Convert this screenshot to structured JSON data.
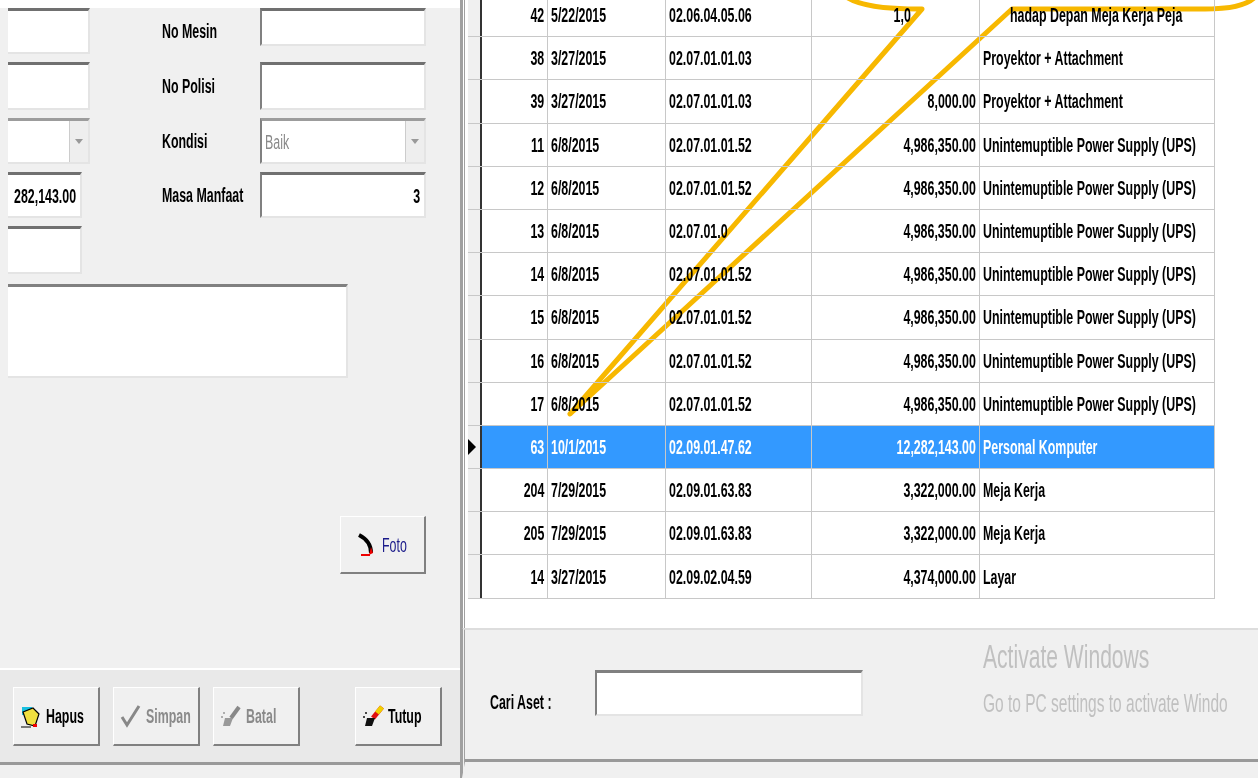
{
  "form": {
    "left_fields": [
      {
        "kind": "text",
        "disabled": false
      },
      {
        "kind": "text",
        "disabled": false
      },
      {
        "kind": "combo",
        "disabled": true
      },
      {
        "kind": "text",
        "disabled": false,
        "value": "282,143.00"
      },
      {
        "kind": "text",
        "disabled": false
      }
    ],
    "fields": [
      {
        "label": "No Mesin",
        "kind": "text",
        "disabled": false
      },
      {
        "label": "No Polisi",
        "kind": "text",
        "disabled": false
      },
      {
        "label": "Kondisi",
        "kind": "combo",
        "disabled": true,
        "value": "Baik"
      },
      {
        "label": "Masa Manfaat",
        "kind": "number",
        "disabled": false,
        "value": "3"
      }
    ],
    "photo_button": {
      "label": "Foto"
    },
    "buttons": [
      {
        "label": "Hapus",
        "kind": "delete",
        "disabled": false
      },
      {
        "label": "Simpan",
        "kind": "save",
        "disabled": true
      },
      {
        "label": "Batal",
        "kind": "cancel",
        "disabled": true
      },
      {
        "label": "Tutup",
        "kind": "close",
        "disabled": false
      }
    ]
  },
  "table": {
    "rows": [
      {
        "id": "42",
        "date": "5/22/2015",
        "code": "02.06.04.05.06",
        "amount": "1,0",
        "name": "hadap Depan Meja Kerja Peja",
        "selected": false
      },
      {
        "id": "38",
        "date": "3/27/2015",
        "code": "02.07.01.01.03",
        "name": "Proyektor + Attachment",
        "selected": false
      },
      {
        "id": "39",
        "date": "3/27/2015",
        "code": "02.07.01.01.03",
        "amount": "8,000.00",
        "name": "Proyektor + Attachment",
        "selected": false
      },
      {
        "id": "11",
        "date": "6/8/2015",
        "code": "02.07.01.01.52",
        "amount": "4,986,350.00",
        "name": "Unintemuptible Power Supply (UPS)",
        "selected": false
      },
      {
        "id": "12",
        "date": "6/8/2015",
        "code": "02.07.01.01.52",
        "amount": "4,986,350.00",
        "name": "Unintemuptible Power Supply (UPS)",
        "selected": false
      },
      {
        "id": "13",
        "date": "6/8/2015",
        "code": "02.07.01.0",
        "amount": "4,986,350.00",
        "name": "Unintemuptible Power Supply (UPS)",
        "selected": false
      },
      {
        "id": "14",
        "date": "6/8/2015",
        "code": "02.07.01.01.52",
        "amount": "4,986,350.00",
        "name": "Unintemuptible Power Supply (UPS)",
        "selected": false
      },
      {
        "id": "15",
        "date": "6/8/2015",
        "code": "02.07.01.01.52",
        "amount": "4,986,350.00",
        "name": "Unintemuptible Power Supply (UPS)",
        "selected": false
      },
      {
        "id": "16",
        "date": "6/8/2015",
        "code": "02.07.01.01.52",
        "amount": "4,986,350.00",
        "name": "Unintemuptible Power Supply (UPS)",
        "selected": false
      },
      {
        "id": "17",
        "date": "6/8/2015",
        "code": "02.07.01.01.52",
        "amount": "4,986,350.00",
        "name": "Unintemuptible Power Supply (UPS)",
        "selected": false
      },
      {
        "id": "63",
        "date": "10/1/2015",
        "code": "02.09.01.47.62",
        "amount": "12,282,143.00",
        "name": "Personal Komputer",
        "selected": true
      },
      {
        "id": "204",
        "date": "7/29/2015",
        "code": "02.09.01.63.83",
        "amount": "3,322,000.00",
        "name": "Meja Kerja",
        "selected": false
      },
      {
        "id": "205",
        "date": "7/29/2015",
        "code": "02.09.01.63.83",
        "amount": "3,322,000.00",
        "name": "Meja Kerja",
        "selected": false
      },
      {
        "id": "14",
        "date": "3/27/2015",
        "code": "02.09.02.04.59",
        "amount": "4,374,000.00",
        "name": "Layar",
        "selected": false
      }
    ]
  },
  "search": {
    "label": "Cari Aset :"
  },
  "os_notice": {
    "title": "Activate Windows",
    "text": "Go to PC settings to activate Windo"
  },
  "annotation": {
    "kind": "callout"
  }
}
